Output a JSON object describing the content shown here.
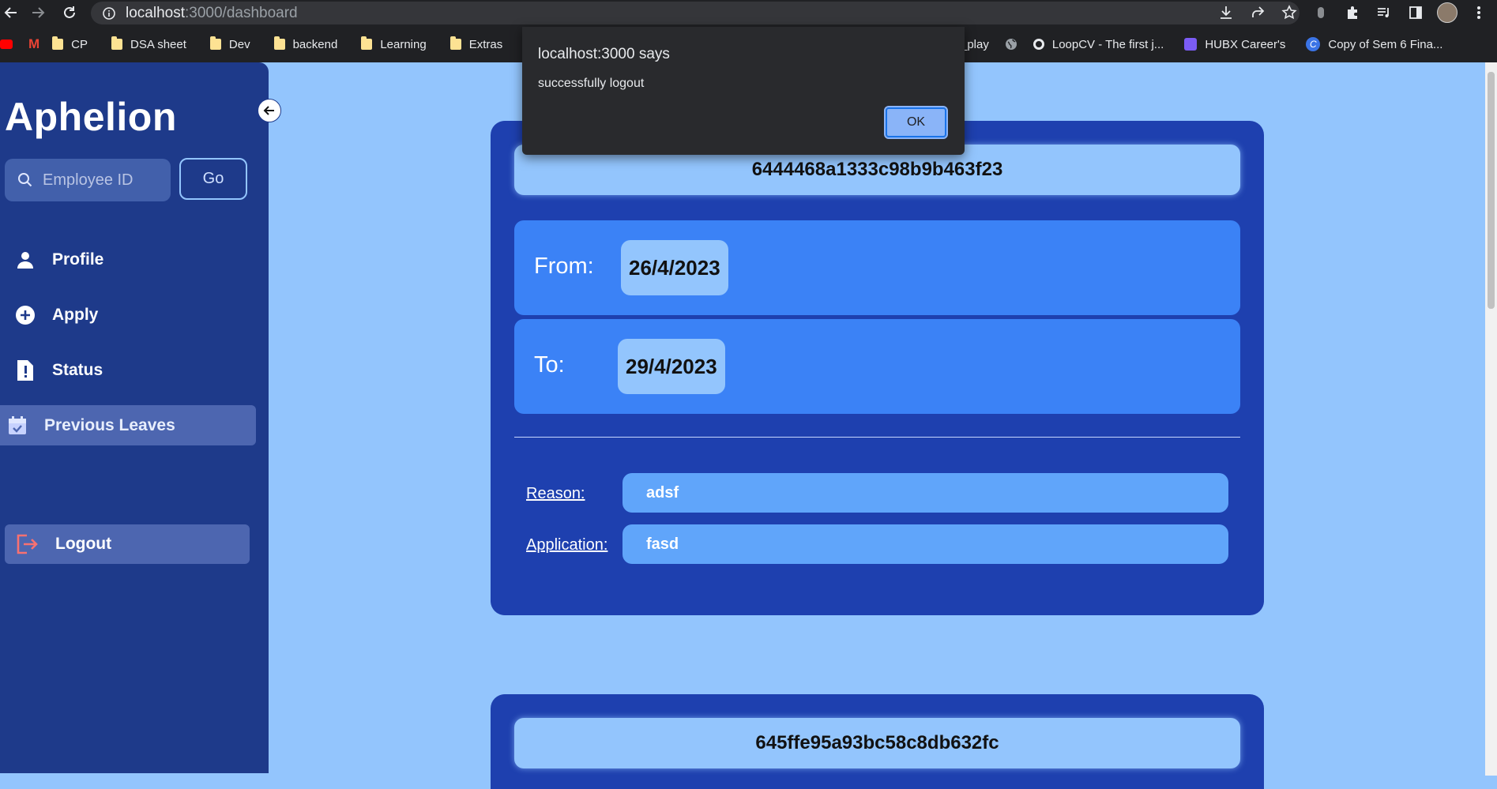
{
  "browser": {
    "url_host": "localhost",
    "url_rest": ":3000/dashboard",
    "bookmarks": [
      {
        "label": "CP",
        "icon": "folder-icon"
      },
      {
        "label": "DSA sheet",
        "icon": "folder-icon"
      },
      {
        "label": "Dev",
        "icon": "folder-icon"
      },
      {
        "label": "backend",
        "icon": "folder-icon"
      },
      {
        "label": "Learning",
        "icon": "folder-icon"
      },
      {
        "label": "Extras",
        "icon": "folder-icon"
      }
    ],
    "bookmarks_right": [
      {
        "label": "_play",
        "icon": "none"
      },
      {
        "label": "",
        "icon": "globe-icon"
      },
      {
        "label": "LoopCV - The first j...",
        "icon": "loopcv-icon"
      },
      {
        "label": "HUBX Career's",
        "icon": "list-icon"
      },
      {
        "label": "Copy of Sem 6 Fina...",
        "icon": "canva-icon"
      }
    ]
  },
  "alert": {
    "title": "localhost:3000 says",
    "message": "successfully logout",
    "ok_label": "OK"
  },
  "sidebar": {
    "brand": "Aphelion",
    "search_placeholder": "Employee ID",
    "go_label": "Go",
    "items": [
      {
        "label": "Profile",
        "icon": "person-icon"
      },
      {
        "label": "Apply",
        "icon": "plus-circle-icon"
      },
      {
        "label": "Status",
        "icon": "file-alert-icon"
      }
    ],
    "active_item": {
      "label": "Previous Leaves",
      "icon": "calendar-check-icon"
    },
    "logout_label": "Logout"
  },
  "leaves": [
    {
      "id": "6444468a1333c98b9b463f23",
      "from_label": "From:",
      "from": "26/4/2023",
      "to_label": "To:",
      "to": "29/4/2023",
      "reason_label": "Reason:",
      "reason": "adsf",
      "application_label": "Application:",
      "application": "fasd"
    },
    {
      "id": "645ffe95a93bc58c8db632fc"
    }
  ]
}
